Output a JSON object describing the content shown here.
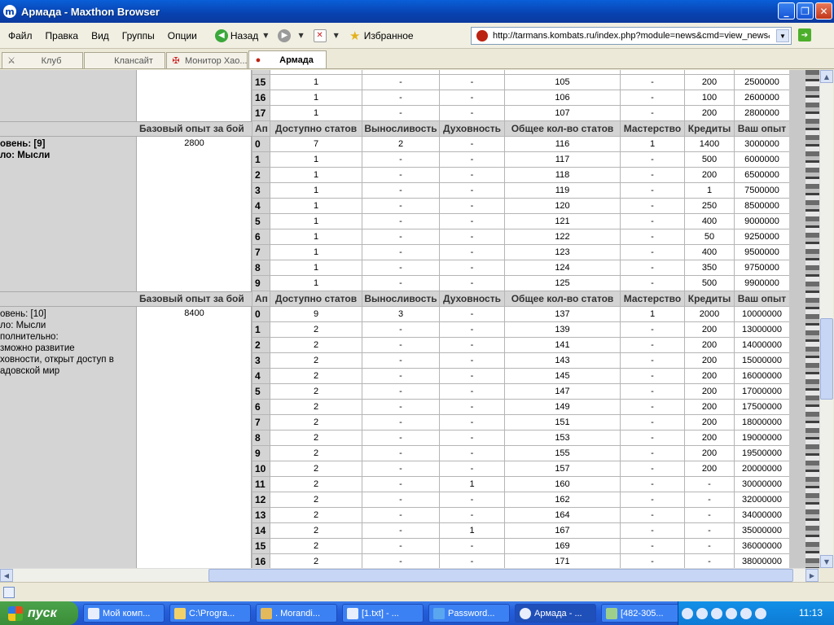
{
  "window": {
    "title": "Армада - Maxthon Browser"
  },
  "menu": [
    "Файл",
    "Правка",
    "Вид",
    "Группы",
    "Опции"
  ],
  "toolbar": {
    "back_label": "Назад",
    "favorites_label": "Избранное"
  },
  "address": {
    "url": "http://tarmans.kombats.ru/index.php?module=news&cmd=view_news&"
  },
  "tabs": [
    {
      "label": "Клуб"
    },
    {
      "label": "Клансайт"
    },
    {
      "label": "Монитор Хао..."
    },
    {
      "label": "Армада"
    }
  ],
  "table": {
    "exp_header": "Базовый опыт за бой",
    "headers": [
      "Ап",
      "Доступно статов",
      "Выносливость",
      "Духовность",
      "Общее кол-во статов",
      "Мастерство",
      "Кредиты",
      "Ваш опыт"
    ],
    "top_rows": [
      [
        "15",
        "1",
        "-",
        "-",
        "105",
        "-",
        "200",
        "2500000"
      ],
      [
        "16",
        "1",
        "-",
        "-",
        "106",
        "-",
        "100",
        "2600000"
      ],
      [
        "17",
        "1",
        "-",
        "-",
        "107",
        "-",
        "200",
        "2800000"
      ]
    ],
    "level9": {
      "name": "овень: [9]\nло: Мысли",
      "exp": "2800",
      "rows": [
        [
          "0",
          "7",
          "2",
          "-",
          "116",
          "1",
          "1400",
          "3000000"
        ],
        [
          "1",
          "1",
          "-",
          "-",
          "117",
          "-",
          "500",
          "6000000"
        ],
        [
          "2",
          "1",
          "-",
          "-",
          "118",
          "-",
          "200",
          "6500000"
        ],
        [
          "3",
          "1",
          "-",
          "-",
          "119",
          "-",
          "1",
          "7500000"
        ],
        [
          "4",
          "1",
          "-",
          "-",
          "120",
          "-",
          "250",
          "8500000"
        ],
        [
          "5",
          "1",
          "-",
          "-",
          "121",
          "-",
          "400",
          "9000000"
        ],
        [
          "6",
          "1",
          "-",
          "-",
          "122",
          "-",
          "50",
          "9250000"
        ],
        [
          "7",
          "1",
          "-",
          "-",
          "123",
          "-",
          "400",
          "9500000"
        ],
        [
          "8",
          "1",
          "-",
          "-",
          "124",
          "-",
          "350",
          "9750000"
        ],
        [
          "9",
          "1",
          "-",
          "-",
          "125",
          "-",
          "500",
          "9900000"
        ]
      ]
    },
    "level10": {
      "name": "овень: [10]\nло: Мысли\nполнительно:\nзможно развитие\nховности, открыт доступ в\nадовской мир",
      "exp": "8400",
      "rows": [
        [
          "0",
          "9",
          "3",
          "-",
          "137",
          "1",
          "2000",
          "10000000"
        ],
        [
          "1",
          "2",
          "-",
          "-",
          "139",
          "-",
          "200",
          "13000000"
        ],
        [
          "2",
          "2",
          "-",
          "-",
          "141",
          "-",
          "200",
          "14000000"
        ],
        [
          "3",
          "2",
          "-",
          "-",
          "143",
          "-",
          "200",
          "15000000"
        ],
        [
          "4",
          "2",
          "-",
          "-",
          "145",
          "-",
          "200",
          "16000000"
        ],
        [
          "5",
          "2",
          "-",
          "-",
          "147",
          "-",
          "200",
          "17000000"
        ],
        [
          "6",
          "2",
          "-",
          "-",
          "149",
          "-",
          "200",
          "17500000"
        ],
        [
          "7",
          "2",
          "-",
          "-",
          "151",
          "-",
          "200",
          "18000000"
        ],
        [
          "8",
          "2",
          "-",
          "-",
          "153",
          "-",
          "200",
          "19000000"
        ],
        [
          "9",
          "2",
          "-",
          "-",
          "155",
          "-",
          "200",
          "19500000"
        ],
        [
          "10",
          "2",
          "-",
          "-",
          "157",
          "-",
          "200",
          "20000000"
        ],
        [
          "11",
          "2",
          "-",
          "1",
          "160",
          "-",
          "-",
          "30000000"
        ],
        [
          "12",
          "2",
          "-",
          "-",
          "162",
          "-",
          "-",
          "32000000"
        ],
        [
          "13",
          "2",
          "-",
          "-",
          "164",
          "-",
          "-",
          "34000000"
        ],
        [
          "14",
          "2",
          "-",
          "1",
          "167",
          "-",
          "-",
          "35000000"
        ],
        [
          "15",
          "2",
          "-",
          "-",
          "169",
          "-",
          "-",
          "36000000"
        ],
        [
          "16",
          "2",
          "-",
          "-",
          "171",
          "-",
          "-",
          "38000000"
        ]
      ]
    }
  },
  "taskbar": {
    "start_label": "пуск",
    "buttons": [
      "Мой комп...",
      "C:\\Progra...",
      ". Morandi...",
      "[1.txt] - ...",
      "Password...",
      "Армада - ...",
      "[482-305..."
    ],
    "clock": "11:13"
  }
}
